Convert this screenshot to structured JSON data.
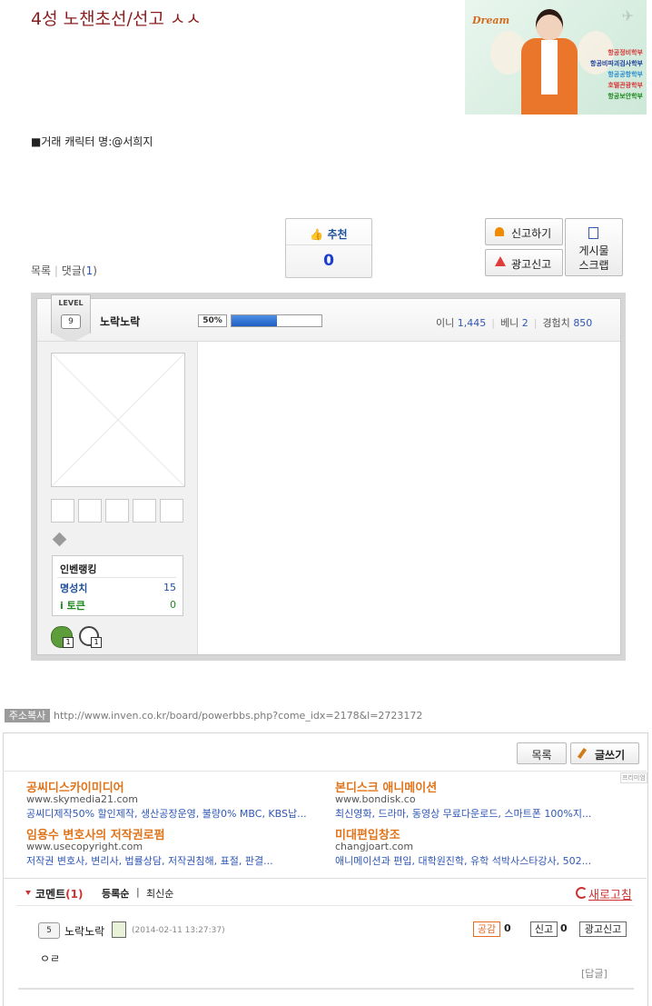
{
  "post": {
    "title": "4성 노챈초선/선고 ㅅㅅ",
    "trade_line": "■거래 캐릭터 명:@서희지",
    "recommend_label": "추천",
    "recommend_count": "0",
    "report_label": "신고하기",
    "ad_report_label": "광고신고",
    "scrap_label_1": "게시물",
    "scrap_label_2": "스크랩",
    "list_label": "목록",
    "comments_label": "댓글",
    "comments_count": "1"
  },
  "ad_banner": {
    "dream": "Dream",
    "majors": [
      "항공정비학부",
      "항공비파괴검사학부",
      "항공공항학부",
      "호텔관광학부",
      "항공보안학부"
    ],
    "major_colors": [
      "#d83a3a",
      "#1d3f9c",
      "#2d8fd0",
      "#d83a3a",
      "#1e8a1e"
    ]
  },
  "profile": {
    "level_label": "LEVEL",
    "level": "9",
    "nickname": "노락노락",
    "exp_percent_label": "50%",
    "exp_fraction": 0.5,
    "inni_label": "이니",
    "inni": "1,445",
    "beni_label": "베니",
    "beni": "2",
    "exp_label": "경험치",
    "exp": "850",
    "rank_title": "인벤랭킹",
    "fame_label": "명성치",
    "fame": "15",
    "token_label": "i 토큰",
    "token": "0",
    "badge_counts": [
      "1",
      "1"
    ]
  },
  "url": {
    "tag": "주소복사",
    "text": "http://www.inven.co.kr/board/powerbbs.php?come_idx=2178&l=2723172"
  },
  "board": {
    "list_label": "목록",
    "write_label": "글쓰기",
    "premium_label": "프리미엄"
  },
  "ads": [
    {
      "title": "공씨디스카이미디어",
      "url": "www.skymedia21.com",
      "desc": "공씨디제작50% 할인제작, 생산공장운영, 불량0% MBC, KBS납..."
    },
    {
      "title": "본디스크 애니메이션",
      "url": "www.bondisk.co",
      "desc": "최신영화, 드라마, 동영상 무료다운로드, 스마트폰 100%지..."
    },
    {
      "title": "임용수 변호사의 저작권로펌",
      "url": "www.usecopyright.com",
      "desc": "저작권 변호사, 변리사, 법률상담, 저작권침해, 표절, 판결..."
    },
    {
      "title": "미대편입창조",
      "url": "changjoart.com",
      "desc": "애니메이션과 편입, 대학원진학, 유학 석박사스타강사, 502..."
    }
  ],
  "comments": {
    "title": "코멘트",
    "count": "(1)",
    "sort_register": "등록순",
    "sort_sep": "|",
    "sort_latest": "최신순",
    "refresh_label": "새로고침",
    "items": [
      {
        "level": "5",
        "nickname": "노락노락",
        "date": "(2014-02-11 13:27:37)",
        "like_label": "공감",
        "likes": "0",
        "report_label": "신고",
        "reports": "0",
        "ad_report_label": "광고신고",
        "text": "ㅇㄹ",
        "reply_label": "[답글]"
      }
    ]
  }
}
